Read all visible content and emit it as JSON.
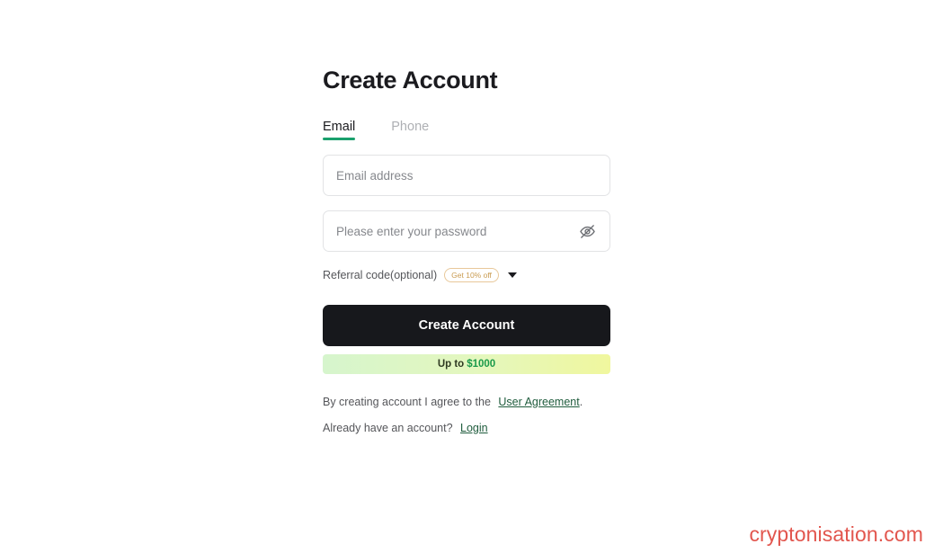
{
  "page": {
    "title": "Create Account"
  },
  "tabs": [
    {
      "label": "Email",
      "active": true
    },
    {
      "label": "Phone",
      "active": false
    }
  ],
  "form": {
    "email": {
      "placeholder": "Email address",
      "value": ""
    },
    "password": {
      "placeholder": "Please enter your password",
      "value": "",
      "toggle_icon": "eye-off-icon"
    },
    "referral": {
      "label": "Referral code(optional)",
      "badge": "Get 10% off",
      "expand_icon": "chevron-down-icon"
    },
    "submit_label": "Create Account",
    "promo": {
      "prefix": "Up to",
      "amount": "$1000"
    }
  },
  "legal": {
    "agreement_prefix": "By creating account I agree to the",
    "agreement_link": "User Agreement",
    "agreement_suffix": ".",
    "login_prompt": "Already have an account?",
    "login_link": "Login"
  },
  "watermark": "cryptonisation.com",
  "colors": {
    "accent_green": "#1aa06d",
    "button_dark": "#17181c",
    "link_green": "#1f5c3d",
    "badge_gold": "#c99b50",
    "promo_amount_green": "#1a9a4a",
    "watermark_red": "#e2564e"
  }
}
